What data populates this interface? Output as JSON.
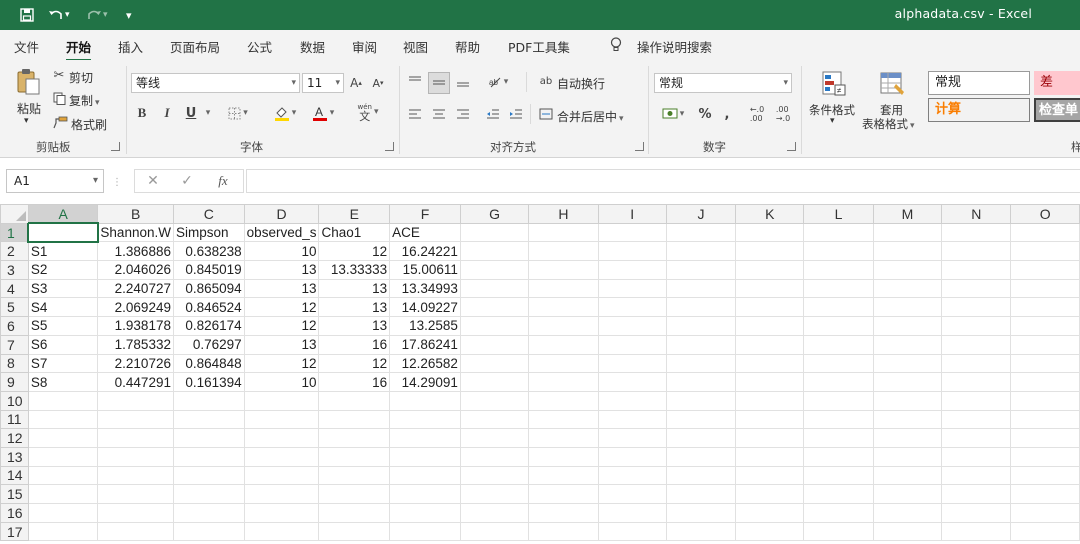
{
  "window": {
    "title": "alphadata.csv  -  Excel"
  },
  "quick_access": {
    "save_icon": "save-icon",
    "undo_icon": "undo-icon",
    "redo_icon": "redo-icon",
    "customize_icon": "customize-icon"
  },
  "tabs": [
    "文件",
    "开始",
    "插入",
    "页面布局",
    "公式",
    "数据",
    "审阅",
    "视图",
    "帮助",
    "PDF工具集"
  ],
  "tell_me": "操作说明搜索",
  "ribbon": {
    "clipboard": {
      "paste": "粘贴",
      "cut": "剪切",
      "copy": "复制",
      "format_painter": "格式刷",
      "label": "剪贴板"
    },
    "font": {
      "name": "等线",
      "size": "11",
      "bold": "B",
      "italic": "I",
      "underline": "U",
      "label": "字体",
      "wen": "wén",
      "wen_char": "文"
    },
    "alignment": {
      "wrap": "自动换行",
      "merge": "合并后居中",
      "label": "对齐方式"
    },
    "number": {
      "format": "常规",
      "percent": "%",
      "comma": ",",
      "label": "数字"
    },
    "styles": {
      "conditional": "条件格式",
      "table_line1": "套用",
      "table_line2": "表格格式",
      "normal": "常规",
      "bad": "差",
      "calc": "计算",
      "check": "检查单",
      "label_partial": "样"
    }
  },
  "formula_bar": {
    "cell_ref": "A1",
    "formula": ""
  },
  "sheet": {
    "columns": [
      "A",
      "B",
      "C",
      "D",
      "E",
      "F",
      "G",
      "H",
      "I",
      "J",
      "K",
      "L",
      "M",
      "N",
      "O"
    ],
    "rows": [
      [
        "",
        "Shannon.W",
        "Simpson",
        "observed_s",
        "Chao1",
        "ACE"
      ],
      [
        "S1",
        "1.386886",
        "0.638238",
        "10",
        "12",
        "16.24221"
      ],
      [
        "S2",
        "2.046026",
        "0.845019",
        "13",
        "13.33333",
        "15.00611"
      ],
      [
        "S3",
        "2.240727",
        "0.865094",
        "13",
        "13",
        "13.34993"
      ],
      [
        "S4",
        "2.069249",
        "0.846524",
        "12",
        "13",
        "14.09227"
      ],
      [
        "S5",
        "1.938178",
        "0.826174",
        "12",
        "13",
        "13.2585"
      ],
      [
        "S6",
        "1.785332",
        "0.76297",
        "13",
        "16",
        "17.86241"
      ],
      [
        "S7",
        "2.210726",
        "0.864848",
        "12",
        "12",
        "12.26582"
      ],
      [
        "S8",
        "0.447291",
        "0.161394",
        "10",
        "16",
        "14.29091"
      ]
    ],
    "row_numbers": [
      "1",
      "2",
      "3",
      "4",
      "5",
      "6",
      "7",
      "8",
      "9",
      "10",
      "11",
      "12",
      "13",
      "14",
      "15",
      "16",
      "17"
    ]
  },
  "colors": {
    "excel_green": "#217346",
    "bad_fill": "#ffc7ce",
    "bad_text": "#9c0006",
    "calc_text": "#fa7d00",
    "check_fill": "#a5a5a5"
  }
}
